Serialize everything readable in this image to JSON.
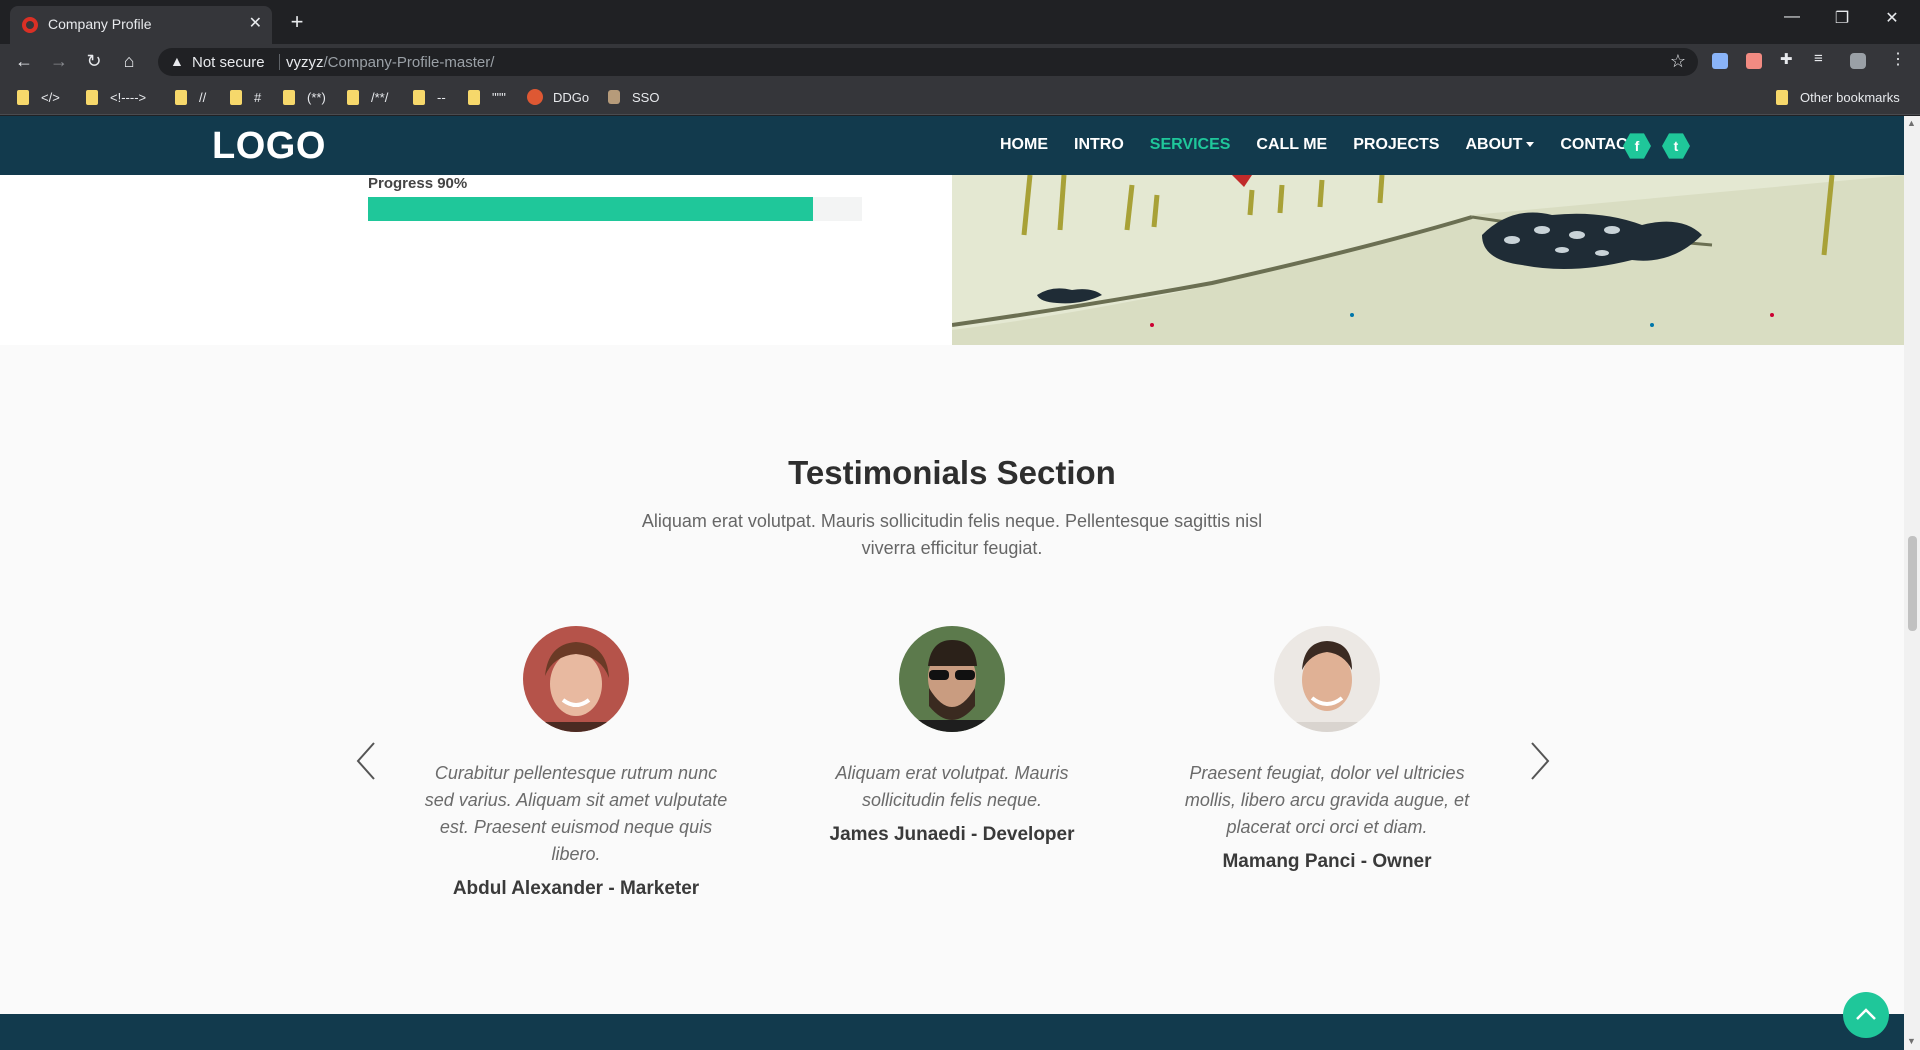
{
  "browser": {
    "tab_title": "Company Profile",
    "security_label": "Not secure",
    "url_host": "vyzyz",
    "url_path": "/Company-Profile-master/",
    "bookmarks": [
      "</>",
      "<!---->",
      "//",
      "#",
      "(**)",
      "/**/",
      "--",
      "\"\"\"",
      "DDGo",
      "SSO"
    ],
    "other_bookmarks": "Other bookmarks"
  },
  "site": {
    "logo": "LOGO",
    "menu": [
      "HOME",
      "INTRO",
      "SERVICES",
      "CALL ME",
      "PROJECTS",
      "ABOUT",
      "CONTACT"
    ],
    "active_menu": "SERVICES",
    "social": [
      "f",
      "t"
    ]
  },
  "progress": {
    "label": "Progress 90%",
    "value": 0.9
  },
  "testimonials": {
    "title": "Testimonials Section",
    "subtitle": "Aliquam erat volutpat. Mauris sollicitudin felis neque. Pellentesque sagittis nisl viverra efficitur feugiat.",
    "items": [
      {
        "quote": "Curabitur pellentesque rutrum nunc sed varius. Aliquam sit amet vulputate est. Praesent euismod neque quis libero.",
        "author": "Abdul Alexander - Marketer"
      },
      {
        "quote": "Aliquam erat volutpat. Mauris sollicitudin felis neque.",
        "author": "James Junaedi - Developer"
      },
      {
        "quote": "Praesent feugiat, dolor vel ultricies mollis, libero arcu gravida augue, et placerat orci orci et diam.",
        "author": "Mamang Panci - Owner"
      }
    ]
  },
  "colors": {
    "nav_bg": "#123a4d",
    "accent": "#1fc79a"
  }
}
